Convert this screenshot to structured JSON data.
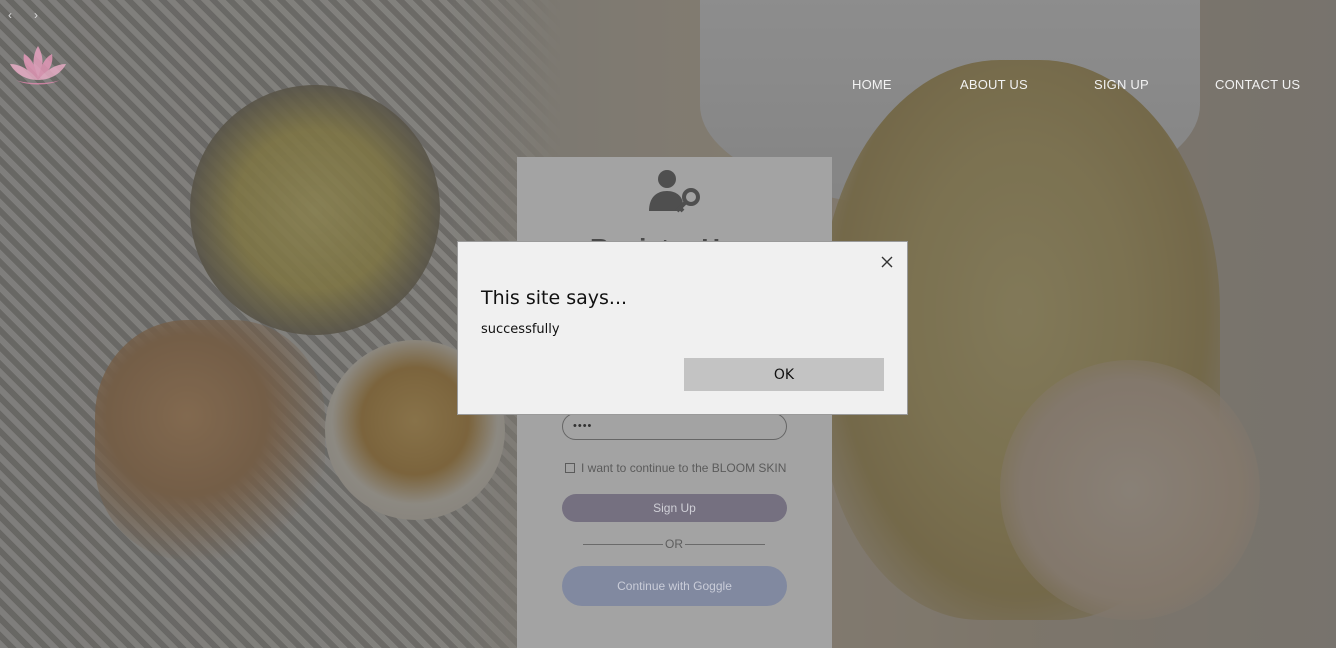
{
  "nav": {
    "back_glyph": "‹",
    "forward_glyph": "›",
    "items": [
      "HOME",
      "ABOUT US",
      "SIGN UP",
      "CONTACT US"
    ]
  },
  "logo": {
    "icon": "lotus-logo"
  },
  "register_card": {
    "icon": "user-key-icon",
    "title": "Register Here",
    "password_value": "••••",
    "consent_label": "I want to continue to the BLOOM SKIN",
    "signup_label": "Sign Up",
    "divider_label": "OR",
    "google_label": "Continue with Goggle"
  },
  "dialog": {
    "title": "This site says...",
    "message": "successfully",
    "ok_label": "OK"
  },
  "colors": {
    "accent_purple": "#b9b4e6",
    "google_blue": "#c4d2f5",
    "logo_pink": "#f4a7c8"
  }
}
